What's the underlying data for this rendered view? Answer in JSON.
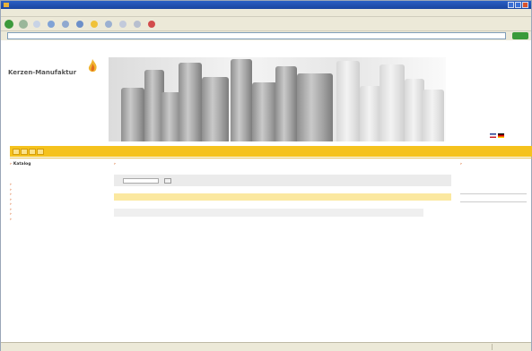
{
  "browser": {
    "title": "",
    "menu": [
      "",
      "",
      "",
      "",
      "",
      ""
    ],
    "toolbar_labels": [
      "",
      ""
    ],
    "address_label": "",
    "status": ""
  },
  "site": {
    "logo_line1": "Kerzen-Manufaktur",
    "logo_line2": "",
    "logo_line3": "",
    "nav_tabs": [
      "",
      "",
      "",
      ""
    ],
    "sidebar_title": "Katalog",
    "sidebar_items": [
      "",
      "",
      "",
      "",
      "",
      "",
      "",
      ""
    ],
    "main_title": "",
    "search_label": "",
    "search_button": "",
    "table_headers": [
      "",
      "",
      "",
      "",
      "",
      "",
      "",
      "",
      "",
      "",
      "",
      ""
    ],
    "table_rows": [
      [
        "",
        "",
        "",
        "",
        "",
        "",
        "",
        "",
        "",
        "",
        ""
      ],
      [
        "",
        "",
        "",
        "",
        "",
        "",
        "",
        "",
        "",
        "",
        ""
      ],
      [
        "",
        "",
        "",
        "",
        "",
        "",
        "",
        "",
        "",
        "",
        ""
      ]
    ],
    "right_title": "",
    "right_box": ""
  },
  "colors": {
    "nav_bar": "#f5c21d",
    "table_header": "#fbe8a0",
    "accent": "#d14a00"
  }
}
